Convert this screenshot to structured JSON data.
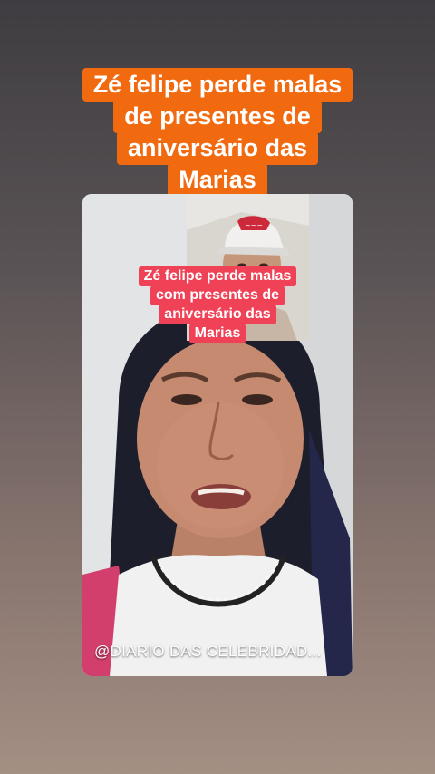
{
  "header": {
    "title_lines": [
      "Zé felipe perde malas",
      "de presentes de",
      "aniversário das",
      "Marias"
    ]
  },
  "video": {
    "overlay_lines": [
      "Zé felipe perde malas",
      "com presentes de",
      "aniversário das",
      "Marias"
    ],
    "watermark": "@DIARIO DAS CELEBRIDAD..."
  },
  "colors": {
    "title_background": "#f26a10",
    "overlay_background": "#ef4257"
  }
}
